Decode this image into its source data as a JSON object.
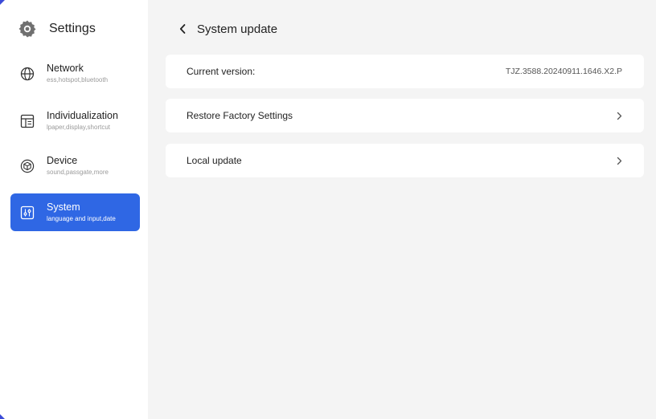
{
  "sidebar": {
    "app_title": "Settings",
    "items": [
      {
        "label": "Network",
        "sub": "ess,hotspot,bluetooth",
        "icon": "globe-icon",
        "active": false
      },
      {
        "label": "Individualization",
        "sub": "lpaper,display,shortcut",
        "icon": "layout-icon",
        "active": false
      },
      {
        "label": "Device",
        "sub": "sound,passgate,more",
        "icon": "cube-icon",
        "active": false
      },
      {
        "label": "System",
        "sub": "language and input,date",
        "icon": "sliders-icon",
        "active": true
      }
    ]
  },
  "main": {
    "page_title": "System update",
    "rows": [
      {
        "label": "Current version:",
        "value": "TJZ.3588.20240911.1646.X2.P"
      },
      {
        "label": "Restore Factory Settings",
        "icon": "chevron-right-icon"
      },
      {
        "label": "Local update",
        "icon": "chevron-right-icon"
      }
    ]
  },
  "colors": {
    "accent": "#2f67e4",
    "main_background": "#f4f4f4",
    "sidebar_background": "#ffffff",
    "card_background": "#ffffff"
  }
}
